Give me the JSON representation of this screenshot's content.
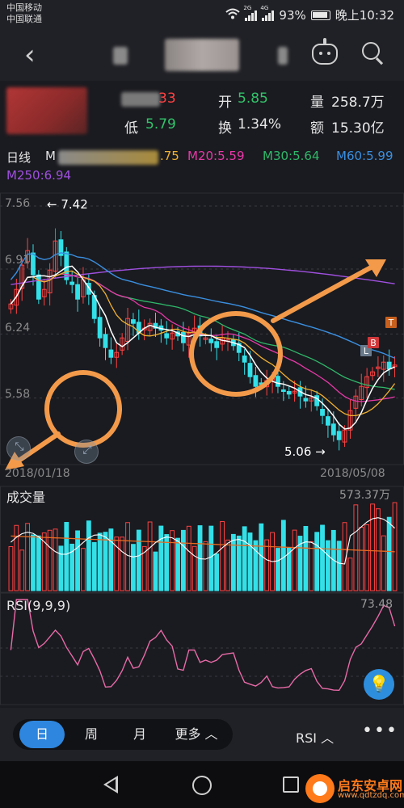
{
  "status_bar": {
    "carrier1": "中国移动",
    "carrier2": "中国联通",
    "net_badge1": "2G",
    "net_badge2": "4G",
    "battery": "93%",
    "time": "晚上10:32"
  },
  "header": {
    "back_icon": "chevron-left-icon",
    "robot_icon": "robot-icon",
    "search_icon": "search-icon"
  },
  "quote": {
    "open_label": "开",
    "open_value": "5.85",
    "volume_label": "量",
    "volume_value": "258.7万",
    "low_label": "低",
    "low_value": "5.79",
    "turnover_label": "换",
    "turnover_value": "1.34%",
    "amount_label": "额",
    "amount_value": "15.30亿",
    "high_value_partial": "33"
  },
  "ma_row": {
    "period": "日线",
    "m5_prefix": "M",
    "m10_tail": ".75",
    "m20": "M20:5.59",
    "m30": "M30:5.64",
    "m60": "M60:5.99",
    "m250": "M250:6.94"
  },
  "colors": {
    "up": "#ff4242",
    "down": "#33e0e8",
    "ma5": "#ffffff",
    "ma10": "#f0b030",
    "ma20": "#e838a8",
    "ma30": "#2fb86a",
    "ma60": "#3a8fe0",
    "ma250": "#a050e0",
    "annotation": "#f39a4a"
  },
  "price_chart": {
    "y_ticks": [
      "7.56",
      "6.91",
      "6.24",
      "5.58"
    ],
    "start_date": "2018/01/18",
    "end_date": "2018/05/08",
    "high_annotation": "7.42",
    "low_annotation": "5.06",
    "marker_l": "L",
    "marker_b": "B",
    "marker_t": "T"
  },
  "volume_pane": {
    "title": "成交量",
    "max_value": "573.37万"
  },
  "rsi_pane": {
    "title": "RSI(9,9,9)",
    "value": "73.48"
  },
  "tabs": {
    "day": "日",
    "week": "周",
    "month": "月",
    "more": "更多",
    "indicator": "RSI",
    "more_icon": "more-dots-icon"
  },
  "watermark": {
    "brand": "启东安卓网",
    "url": "www.qdtzdq.com"
  },
  "chart_data": {
    "type": "candlestick",
    "x_range": [
      "2018/01/18",
      "2018/05/08"
    ],
    "ylim": [
      5.06,
      7.56
    ],
    "y_ticks": [
      7.56,
      6.91,
      6.24,
      5.58
    ],
    "annotations": [
      {
        "label": "7.42",
        "note": "period high"
      },
      {
        "label": "5.06",
        "note": "period low"
      }
    ],
    "series": [
      {
        "name": "M20",
        "last": 5.59
      },
      {
        "name": "M30",
        "last": 5.64
      },
      {
        "name": "M60",
        "last": 5.99
      },
      {
        "name": "M250",
        "last": 6.94
      }
    ],
    "close": [
      6.55,
      6.7,
      6.95,
      7.1,
      6.85,
      6.6,
      6.7,
      6.9,
      7.2,
      7.05,
      6.8,
      6.75,
      6.6,
      6.8,
      6.65,
      6.4,
      6.2,
      6.1,
      6.0,
      6.05,
      6.2,
      6.4,
      6.35,
      6.25,
      6.3,
      6.35,
      6.3,
      6.28,
      6.2,
      6.25,
      6.22,
      6.15,
      6.25,
      6.3,
      6.22,
      6.2,
      6.15,
      6.1,
      6.2,
      6.18,
      6.12,
      6.05,
      5.95,
      5.8,
      5.7,
      5.72,
      5.76,
      5.78,
      5.7,
      5.66,
      5.62,
      5.65,
      5.6,
      5.55,
      5.58,
      5.5,
      5.4,
      5.3,
      5.2,
      5.15,
      5.25,
      5.45,
      5.6,
      5.7,
      5.8,
      5.85,
      5.9,
      5.95,
      5.88,
      5.92
    ],
    "volume_pane": {
      "title": "成交量",
      "max": "573.37万"
    },
    "rsi_pane": {
      "title": "RSI(9,9,9)",
      "last": 73.48
    }
  }
}
